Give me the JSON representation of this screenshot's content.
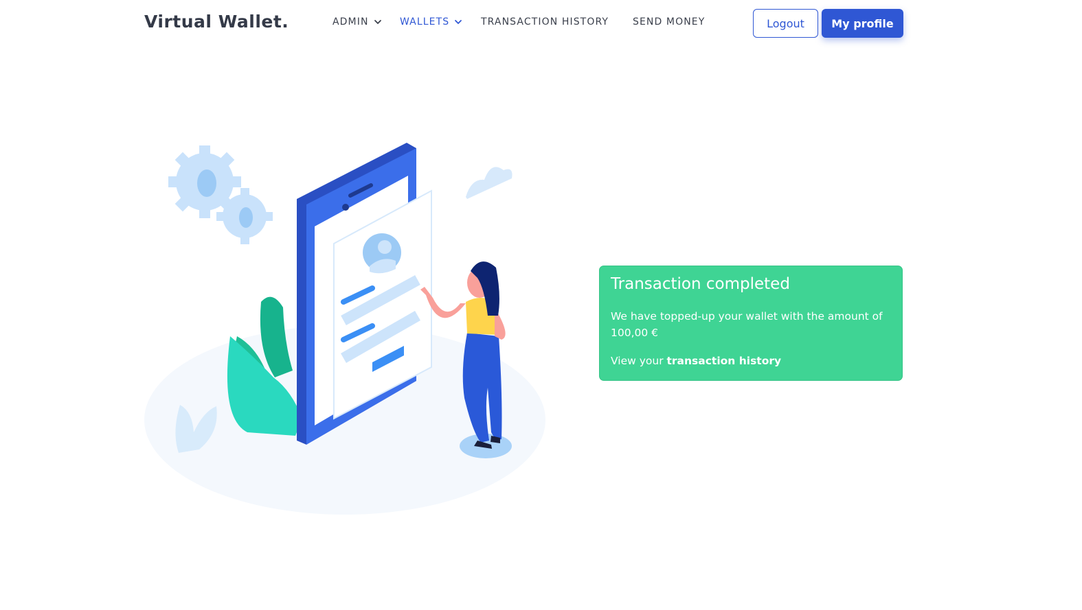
{
  "brand": "Virtual Wallet.",
  "nav": {
    "items": [
      {
        "label": "ADMIN",
        "has_dropdown": true,
        "active": false
      },
      {
        "label": "WALLETS",
        "has_dropdown": true,
        "active": true
      },
      {
        "label": "TRANSACTION HISTORY",
        "has_dropdown": false,
        "active": false
      },
      {
        "label": "SEND MONEY",
        "has_dropdown": false,
        "active": false
      }
    ]
  },
  "buttons": {
    "logout": "Logout",
    "profile": "My profile"
  },
  "alert": {
    "title": "Transaction completed",
    "message": "We have topped-up your wallet with the amount of 100,00 €",
    "link_prefix": "View your ",
    "link_text": "transaction history"
  },
  "colors": {
    "accent": "#2f57d4",
    "success": "#3fd494",
    "text": "#3a3f4b"
  },
  "icons": {
    "dropdown": "chevron-down-icon",
    "illustration": "phone-with-woman-illustration"
  }
}
